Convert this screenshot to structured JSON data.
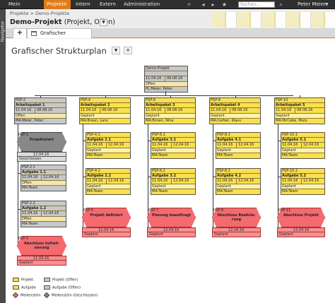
{
  "topnav": {
    "items": [
      "Mein Bereich",
      "Projekte",
      "Intern",
      "Extern",
      "Administration"
    ],
    "search_placeholder": "Suchen...",
    "user": "Peter Meier"
  },
  "sidebar_label": "Navigator",
  "breadcrumb": "Projekte  >  Demo-Projekte",
  "project": {
    "name": "Demo-Projekt",
    "status": "(Projekt, Offen)"
  },
  "tabs": {
    "add": "+",
    "view": "Grafischer Strukturplan"
  },
  "main_title": "Grafischer Strukturplan",
  "root": {
    "psp": "Demo-Projekt",
    "start": "11.04.16",
    "end": "08.08.16",
    "status": "Offen",
    "resp": "PL:Meier, Peter"
  },
  "columns": [
    {
      "top": {
        "psp": "PSP-2",
        "name": "Arbeitspaket 1",
        "start": "11.04.16",
        "end": "08.08.16",
        "status": "Offen",
        "resp": "MA:Meier, Peter"
      },
      "children": [
        {
          "kind": "milestone",
          "grey": true,
          "psp": "PSP-1",
          "name": "Projektstart",
          "date": "12.04.16",
          "status": "Geschlossen",
          "start": ""
        },
        {
          "kind": "box",
          "grey": true,
          "psp": "PSP-2.1",
          "name": "Aufgabe 1.1",
          "start": "11.04.16",
          "end": "12.04.16",
          "status": "Offen",
          "resp": "MA:Team"
        },
        {
          "kind": "box",
          "grey": true,
          "psp": "PSP-2.2",
          "name": "Aufgabe 1.2",
          "start": "11.04.16",
          "end": "12.04.16",
          "status": "Offen",
          "resp": "MA:Team"
        },
        {
          "kind": "milestone",
          "grey": false,
          "psp": "PSP-3",
          "name": "Abschluss Initiali-\nsierung",
          "date": "11.04.16",
          "status": "Geplant",
          "start": ""
        }
      ]
    },
    {
      "top": {
        "psp": "PSP-4",
        "name": "Arbeitspaket 2",
        "start": "11.04.16",
        "end": "08.08.16",
        "status": "Geplant",
        "resp": "MA:Braun, Lara"
      },
      "children": [
        {
          "kind": "box",
          "grey": false,
          "psp": "PSP-4.1",
          "name": "Aufgabe 2.1",
          "start": "11.04.16",
          "end": "12.04.16",
          "status": "Geplant",
          "resp": "MA:Team"
        },
        {
          "kind": "box",
          "grey": false,
          "psp": "PSP-4.2",
          "name": "Aufgabe 2.2",
          "start": "11.04.16",
          "end": "12.04.16",
          "status": "Geplant",
          "resp": "MA:Team"
        },
        {
          "kind": "milestone",
          "grey": false,
          "psp": "PSP-5",
          "name": "Projekt definiert",
          "date": "12.04.16",
          "status": "Geplant",
          "start": ""
        }
      ]
    },
    {
      "top": {
        "psp": "PSP-6",
        "name": "Arbeitspaket 3",
        "start": "11.04.16",
        "end": "08.08.16",
        "status": "Geplant",
        "resp": "MA:Brown, Nina"
      },
      "children": [
        {
          "kind": "box",
          "grey": false,
          "psp": "PSP-6.1",
          "name": "Aufgabe 3.1",
          "start": "11.04.16",
          "end": "12.04.16",
          "status": "Geplant",
          "resp": "MA:Team"
        },
        {
          "kind": "box",
          "grey": false,
          "psp": "PSP-6.2",
          "name": "Aufgabe 3.2",
          "start": "11.04.16",
          "end": "12.04.16",
          "status": "Geplant",
          "resp": "MA:Team"
        },
        {
          "kind": "milestone",
          "grey": false,
          "psp": "PSP-7",
          "name": "Planung beauftragt",
          "date": "12.04.16",
          "status": "Geplant",
          "start": ""
        }
      ]
    },
    {
      "top": {
        "psp": "PSP-8",
        "name": "Arbeitspaket 4",
        "start": "11.04.16",
        "end": "08.08.16",
        "status": "Geplant",
        "resp": "MA:Cerber, Klaus"
      },
      "children": [
        {
          "kind": "box",
          "grey": false,
          "psp": "PSP-8.1",
          "name": "Aufgabe 4.1",
          "start": "11.04.16",
          "end": "12.04.16",
          "status": "Geplant",
          "resp": "MA:Team"
        },
        {
          "kind": "box",
          "grey": false,
          "psp": "PSP-8.2",
          "name": "Aufgabe 4.2",
          "start": "11.04.16",
          "end": "12.04.16",
          "status": "Geplant",
          "resp": "MA:Team"
        },
        {
          "kind": "milestone",
          "grey": false,
          "psp": "PSP-9",
          "name": "Abschluss Realisie-\nrung",
          "date": "12.04.16",
          "status": "Geplant",
          "start": ""
        }
      ]
    },
    {
      "top": {
        "psp": "PSP-10",
        "name": "Arbeitspaket 5",
        "start": "11.04.16",
        "end": "08.08.16",
        "status": "Geplant",
        "resp": "MA:McCabe, Mary"
      },
      "children": [
        {
          "kind": "box",
          "grey": false,
          "psp": "PSP-10.1",
          "name": "Aufgabe 5.1",
          "start": "11.04.16",
          "end": "12.04.16",
          "status": "Geplant",
          "resp": "MA:Team"
        },
        {
          "kind": "box",
          "grey": false,
          "psp": "PSP-10.2",
          "name": "Aufgabe 5.2",
          "start": "11.04.16",
          "end": "12.04.16",
          "status": "Geplant",
          "resp": "MA:Team"
        },
        {
          "kind": "milestone",
          "grey": false,
          "psp": "PSP-11",
          "name": "Abschluss Projekt",
          "date": "12.04.16",
          "status": "Geplant",
          "start": ""
        }
      ]
    }
  ],
  "legend": {
    "projekt": "Projekt",
    "projekt_offen": "Projekt (Offen)",
    "aufgabe": "Aufgabe",
    "aufgabe_offen": "Aufgabe (Offen)",
    "meilenstein": "Meilenstein",
    "meilenstein_geschlossen": "Meilenstein (Geschlossen)"
  },
  "colors": {
    "accent": "#e07b18",
    "task": "#fbe04d",
    "task_open": "#c8c8c8",
    "milestone": "#f46a6e",
    "milestone_closed": "#888888"
  }
}
